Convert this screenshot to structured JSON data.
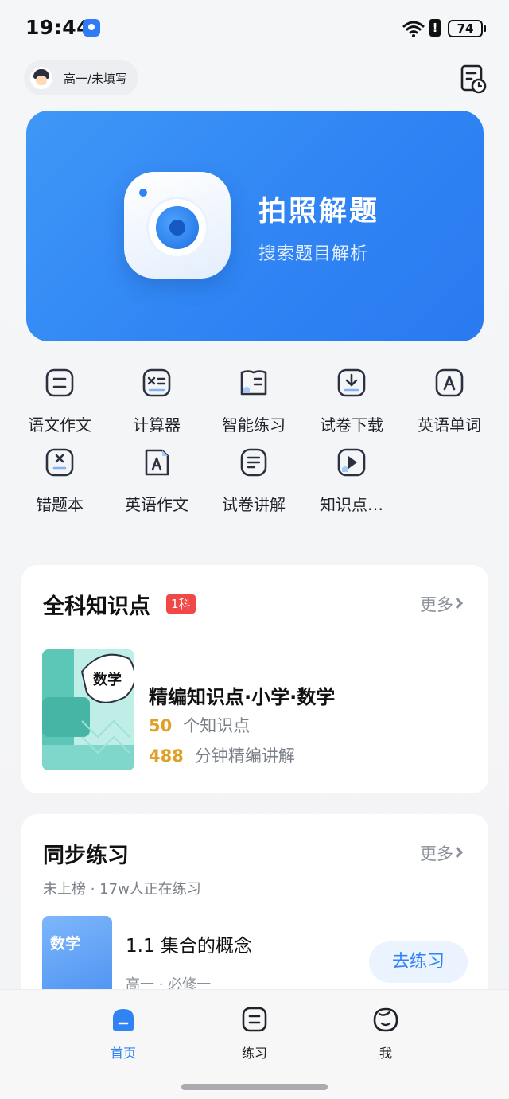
{
  "status_bar": {
    "time": "19:44",
    "warning": "!",
    "battery": "74"
  },
  "header": {
    "grade_label": "高一/未填写"
  },
  "banner": {
    "title": "拍照解题",
    "subtitle": "搜索题目解析"
  },
  "tools": [
    {
      "label": "语文作文",
      "icon": "document-icon"
    },
    {
      "label": "计算器",
      "icon": "calculator-icon"
    },
    {
      "label": "智能练习",
      "icon": "practice-book-icon"
    },
    {
      "label": "试卷下载",
      "icon": "download-icon"
    },
    {
      "label": "英语单词",
      "icon": "letter-a-icon"
    },
    {
      "label": "错题本",
      "icon": "error-book-icon"
    },
    {
      "label": "英语作文",
      "icon": "english-essay-icon"
    },
    {
      "label": "试卷讲解",
      "icon": "paper-explain-icon"
    },
    {
      "label": "知识点…",
      "icon": "play-icon"
    }
  ],
  "knowledge": {
    "title": "全科知识点",
    "badge": "1科",
    "more": "更多",
    "cover_label": "数学",
    "item_title": "精编知识点·小学·数学",
    "count_num": "50",
    "count_text": "个知识点",
    "minutes_num": "488",
    "minutes_text": "分钟精编讲解"
  },
  "practice": {
    "title": "同步练习",
    "more": "更多",
    "subtitle": "未上榜 · 17w人正在练习",
    "cover_label": "数学",
    "item_title": "1.1 集合的概念",
    "item_meta": "高一 · 必修一",
    "button": "去练习"
  },
  "tabs": [
    {
      "label": "首页",
      "active": true
    },
    {
      "label": "练习",
      "active": false
    },
    {
      "label": "我",
      "active": false
    }
  ],
  "colors": {
    "accent": "#2f83f3",
    "badge": "#f04747",
    "number": "#e0a028"
  }
}
